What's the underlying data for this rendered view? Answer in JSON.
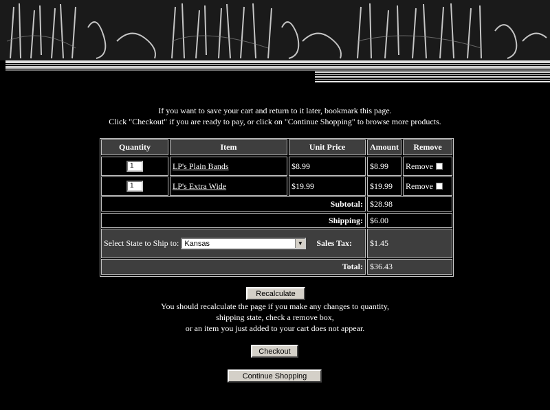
{
  "intro": {
    "line1": "If you want to save your cart and return to it later, bookmark this page.",
    "line2": "Click \"Checkout\" if you are ready to pay, or click on \"Continue Shopping\" to browse more products."
  },
  "cart": {
    "headers": {
      "quantity": "Quantity",
      "item": "Item",
      "unit_price": "Unit Price",
      "amount": "Amount",
      "remove": "Remove"
    },
    "rows": [
      {
        "qty": "1",
        "item": "LP's Plain Bands",
        "unit_price": "$8.99",
        "amount": "$8.99",
        "remove_label": "Remove",
        "remove_checked": false
      },
      {
        "qty": "1",
        "item": "LP's Extra Wide",
        "unit_price": "$19.99",
        "amount": "$19.99",
        "remove_label": "Remove",
        "remove_checked": false
      }
    ],
    "subtotal_label": "Subtotal:",
    "subtotal": "$28.98",
    "shipping_label": "Shipping:",
    "shipping": "$6.00",
    "state_label": "Select State to Ship to:",
    "state_selected": "Kansas",
    "sales_tax_label": "Sales Tax:",
    "sales_tax": "$1.45",
    "total_label": "Total:",
    "total": "$36.43"
  },
  "buttons": {
    "recalculate": "Recalculate",
    "checkout": "Checkout",
    "continue_shopping": "Continue Shopping"
  },
  "recalc_note": {
    "line1": "You should recalculate the page if you make any changes to quantity,",
    "line2": "shipping state, check a remove box,",
    "line3": "or an item you just added to your cart does not appear."
  }
}
